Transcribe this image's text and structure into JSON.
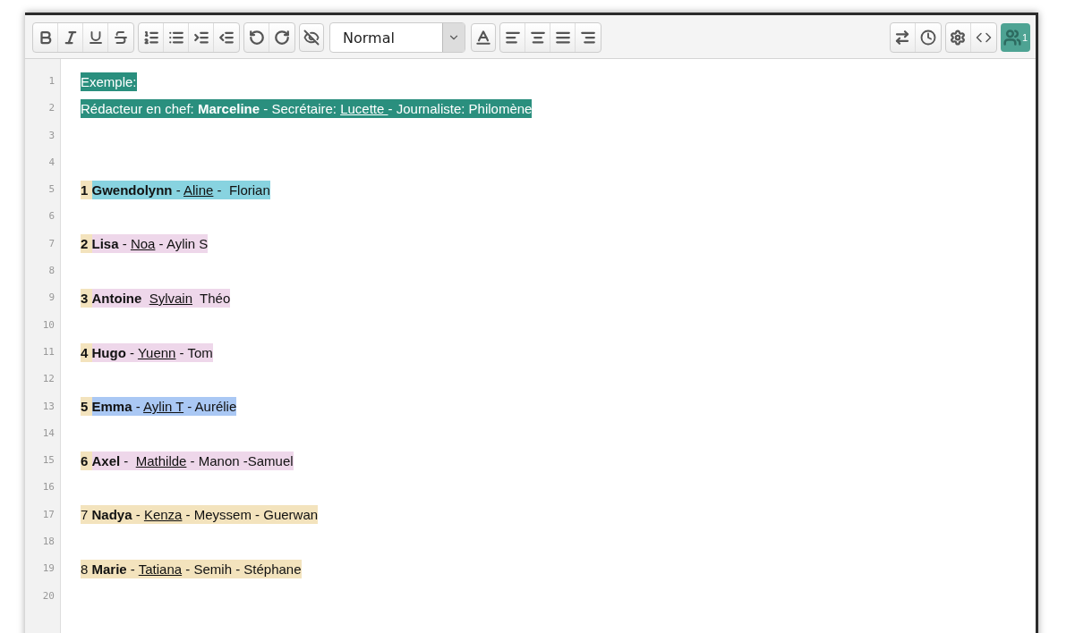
{
  "toolbar": {
    "style_select": "Normal",
    "user_count": "1"
  },
  "lines": [
    {
      "number": "1",
      "segments": [
        {
          "color": "#2a8f7e",
          "parts": [
            {
              "kind": "plain",
              "text": "Exemple:"
            }
          ]
        }
      ]
    },
    {
      "number": "2",
      "segments": [
        {
          "color": "#2a8f7e",
          "parts": [
            {
              "kind": "plain",
              "text": "Rédacteur en chef: "
            },
            {
              "kind": "bold",
              "text": "Marceline"
            },
            {
              "kind": "plain",
              "text": " - Secrétaire: "
            },
            {
              "kind": "underline",
              "text": "Lucette "
            },
            {
              "kind": "plain",
              "text": "- Journaliste: Philomène"
            }
          ]
        }
      ]
    },
    {
      "number": "3"
    },
    {
      "number": "4"
    },
    {
      "number": "5",
      "segments": [
        {
          "color": "#f3e3bd",
          "parts": [
            {
              "kind": "bold",
              "text": "1 "
            }
          ]
        },
        {
          "color": "#88d3e0",
          "parts": [
            {
              "kind": "bold",
              "text": "Gwendolynn"
            },
            {
              "kind": "plain",
              "text": " - "
            },
            {
              "kind": "underline",
              "text": "Aline"
            },
            {
              "kind": "plain",
              "text": " -  Florian"
            }
          ]
        }
      ]
    },
    {
      "number": "6"
    },
    {
      "number": "7",
      "segments": [
        {
          "color": "#f3e3bd",
          "parts": [
            {
              "kind": "bold",
              "text": "2 "
            }
          ]
        },
        {
          "color": "#eed7ea",
          "parts": [
            {
              "kind": "bold",
              "text": "Lisa"
            },
            {
              "kind": "plain",
              "text": " - "
            },
            {
              "kind": "underline",
              "text": "Noa"
            },
            {
              "kind": "plain",
              "text": " - Aylin S"
            }
          ]
        }
      ]
    },
    {
      "number": "8"
    },
    {
      "number": "9",
      "segments": [
        {
          "color": "#f3e3bd",
          "parts": [
            {
              "kind": "bold",
              "text": "3 "
            }
          ]
        },
        {
          "color": "#eed7ea",
          "parts": [
            {
              "kind": "bold",
              "text": "Antoine  "
            },
            {
              "kind": "underline",
              "text": "Sylvain"
            },
            {
              "kind": "plain",
              "text": "  Théo"
            }
          ]
        }
      ]
    },
    {
      "number": "10"
    },
    {
      "number": "11",
      "segments": [
        {
          "color": "#f3e3bd",
          "parts": [
            {
              "kind": "bold",
              "text": "4 "
            }
          ]
        },
        {
          "color": "#eed7ea",
          "parts": [
            {
              "kind": "bold",
              "text": "Hugo"
            },
            {
              "kind": "plain",
              "text": " - "
            },
            {
              "kind": "underline",
              "text": "Yuenn"
            },
            {
              "kind": "plain",
              "text": " - Tom"
            }
          ]
        }
      ]
    },
    {
      "number": "12"
    },
    {
      "number": "13",
      "segments": [
        {
          "color": "#f3e3bd",
          "parts": [
            {
              "kind": "bold",
              "text": "5 "
            }
          ]
        },
        {
          "color": "#aac8f4",
          "parts": [
            {
              "kind": "bold",
              "text": "Emma"
            },
            {
              "kind": "plain",
              "text": " - "
            },
            {
              "kind": "underline",
              "text": "Aylin T"
            },
            {
              "kind": "plain",
              "text": " - Aurélie"
            }
          ]
        }
      ]
    },
    {
      "number": "14"
    },
    {
      "number": "15",
      "segments": [
        {
          "color": "#f3e3bd",
          "parts": [
            {
              "kind": "bold",
              "text": "6 "
            }
          ]
        },
        {
          "color": "#eed7ea",
          "parts": [
            {
              "kind": "bold",
              "text": "Axel"
            },
            {
              "kind": "plain",
              "text": " -  "
            },
            {
              "kind": "underline",
              "text": "Mathilde"
            },
            {
              "kind": "plain",
              "text": " - Manon -Samuel"
            }
          ]
        }
      ]
    },
    {
      "number": "16"
    },
    {
      "number": "17",
      "segments": [
        {
          "color": "#f3e3bd",
          "parts": [
            {
              "kind": "plain",
              "text": "7 "
            },
            {
              "kind": "bold",
              "text": "Nadya"
            },
            {
              "kind": "plain",
              "text": " - "
            },
            {
              "kind": "underline",
              "text": "Kenza"
            },
            {
              "kind": "plain",
              "text": " - Meyssem - Guerwan"
            }
          ]
        }
      ]
    },
    {
      "number": "18"
    },
    {
      "number": "19",
      "segments": [
        {
          "color": "#f3e3bd",
          "parts": [
            {
              "kind": "plain",
              "text": "8 "
            },
            {
              "kind": "bold",
              "text": "Marie"
            },
            {
              "kind": "plain",
              "text": " - "
            },
            {
              "kind": "underline",
              "text": "Tatiana"
            },
            {
              "kind": "plain",
              "text": " - Semih - Stéphane"
            }
          ]
        }
      ]
    },
    {
      "number": "20"
    }
  ]
}
